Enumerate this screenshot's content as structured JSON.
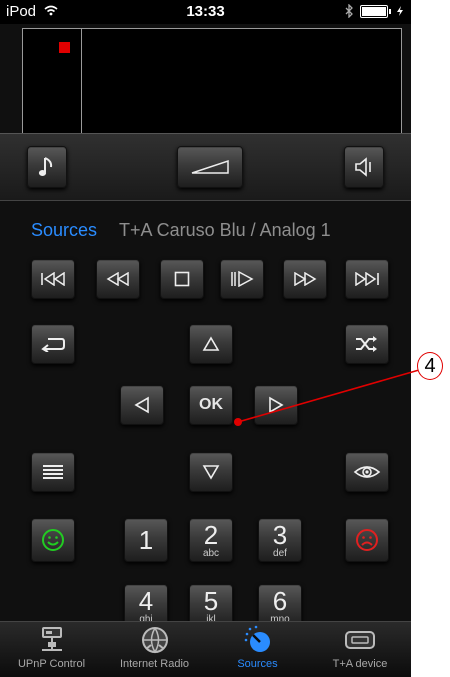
{
  "status_bar": {
    "device": "iPod",
    "time": "13:33"
  },
  "display": {
    "record_indicator_color": "#e00000"
  },
  "volume_row": {
    "music_icon": "music-note-icon",
    "volume_icon": "volume-wedge-icon",
    "mute_icon": "speaker-mute-icon"
  },
  "source_line": {
    "sources_label": "Sources",
    "current_source": "T+A Caruso Blu / Analog 1"
  },
  "transport": {
    "icons": [
      "skip-back-icon",
      "rewind-icon",
      "stop-icon",
      "play-pause-icon",
      "fast-forward-icon",
      "skip-forward-icon"
    ]
  },
  "nav": {
    "ok_label": "OK"
  },
  "keypad": [
    {
      "num": "1",
      "letters": ""
    },
    {
      "num": "2",
      "letters": "abc"
    },
    {
      "num": "3",
      "letters": "def"
    },
    {
      "num": "4",
      "letters": "ghi"
    },
    {
      "num": "5",
      "letters": "jkl"
    },
    {
      "num": "6",
      "letters": "mno"
    }
  ],
  "tabs": [
    {
      "label": "UPnP Control",
      "icon": "network-icon"
    },
    {
      "label": "Internet Radio",
      "icon": "globe-icon"
    },
    {
      "label": "Sources",
      "icon": "knob-icon",
      "active": true
    },
    {
      "label": "T+A device",
      "icon": "device-icon"
    }
  ],
  "annotation": {
    "number": "4"
  },
  "colors": {
    "accent": "#2a8cff",
    "green": "#22cc22",
    "red": "#e02020",
    "annotation": "#e00000"
  }
}
